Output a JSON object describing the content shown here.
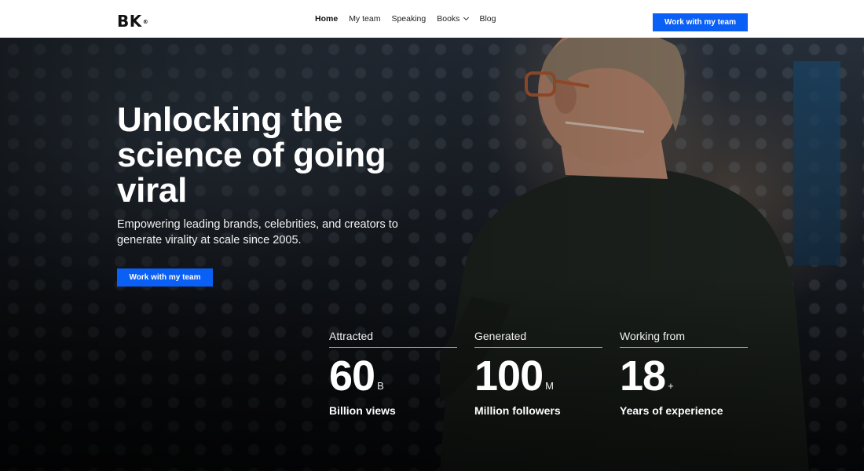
{
  "header": {
    "logo": "BK",
    "logo_mark": "®",
    "nav": [
      {
        "label": "Home",
        "active": true
      },
      {
        "label": "My team"
      },
      {
        "label": "Speaking"
      },
      {
        "label": "Books",
        "has_dropdown": true
      },
      {
        "label": "Blog"
      }
    ],
    "cta_label": "Work with my team"
  },
  "hero": {
    "headline": "Unlocking the science of going viral",
    "subtitle": "Empowering leading brands, celebrities, and creators to generate virality at scale since 2005.",
    "cta_label": "Work with my team"
  },
  "stats": [
    {
      "label": "Attracted",
      "number": "60",
      "unit": "B",
      "caption": "Billion views"
    },
    {
      "label": "Generated",
      "number": "100",
      "unit": "M",
      "caption": "Million followers"
    },
    {
      "label": "Working from",
      "number": "18",
      "unit": "+",
      "caption": "Years of experience"
    }
  ],
  "colors": {
    "accent": "#0a5ff5",
    "header_bg": "#ffffff"
  }
}
